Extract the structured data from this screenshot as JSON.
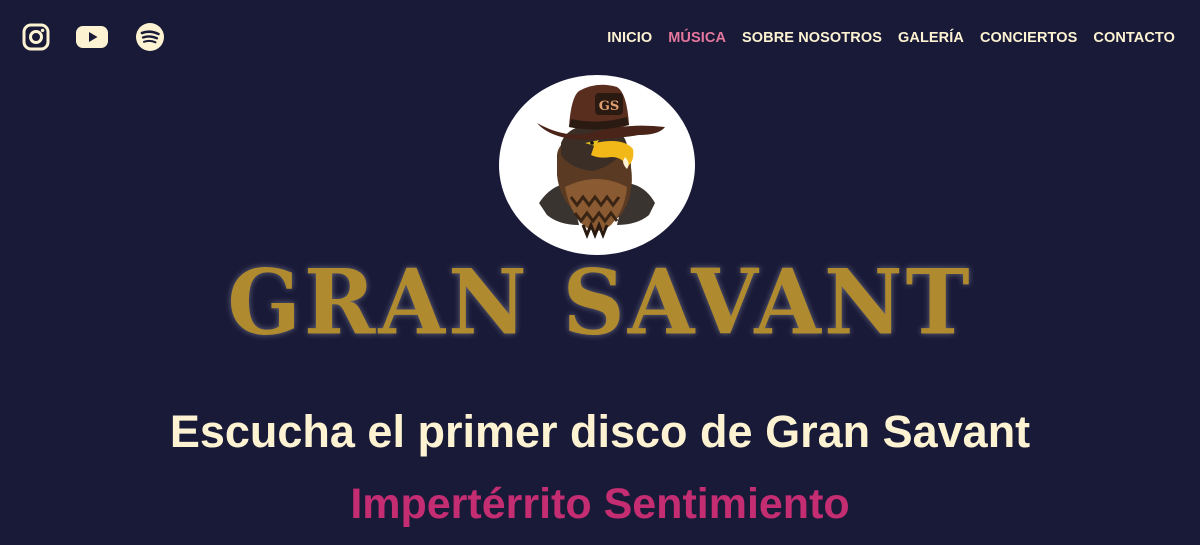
{
  "social": {
    "instagram_icon": "instagram-icon",
    "youtube_icon": "youtube-icon",
    "spotify_icon": "spotify-icon"
  },
  "nav": {
    "items": [
      {
        "label": "INICIO",
        "active": false
      },
      {
        "label": "MÚSICA",
        "active": true
      },
      {
        "label": "SOBRE NOSOTROS",
        "active": false
      },
      {
        "label": "GALERÍA",
        "active": false
      },
      {
        "label": "CONCIERTOS",
        "active": false
      },
      {
        "label": "CONTACTO",
        "active": false
      }
    ]
  },
  "logo": {
    "hat_initials": "GS"
  },
  "brand": {
    "name": "GRAN SAVANT"
  },
  "hero": {
    "headline": "Escucha el primer disco de Gran Savant",
    "album_title": "Impertérrito Sentimiento"
  },
  "colors": {
    "background": "#191a38",
    "nav_text": "#fdf3d2",
    "nav_active": "#e5779d",
    "brand_gold": "#b08a2e",
    "album_magenta": "#c42d72"
  }
}
